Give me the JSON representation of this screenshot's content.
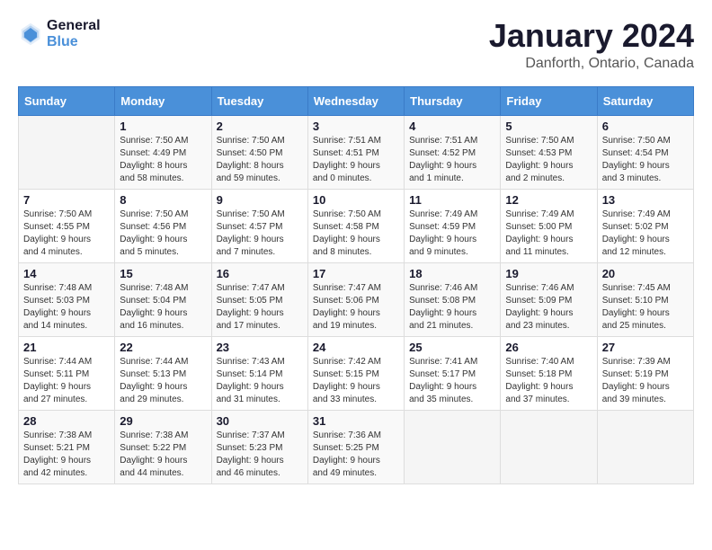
{
  "logo": {
    "line1": "General",
    "line2": "Blue"
  },
  "title": "January 2024",
  "subtitle": "Danforth, Ontario, Canada",
  "days_of_week": [
    "Sunday",
    "Monday",
    "Tuesday",
    "Wednesday",
    "Thursday",
    "Friday",
    "Saturday"
  ],
  "weeks": [
    [
      {
        "day": "",
        "info": ""
      },
      {
        "day": "1",
        "info": "Sunrise: 7:50 AM\nSunset: 4:49 PM\nDaylight: 8 hours\nand 58 minutes."
      },
      {
        "day": "2",
        "info": "Sunrise: 7:50 AM\nSunset: 4:50 PM\nDaylight: 8 hours\nand 59 minutes."
      },
      {
        "day": "3",
        "info": "Sunrise: 7:51 AM\nSunset: 4:51 PM\nDaylight: 9 hours\nand 0 minutes."
      },
      {
        "day": "4",
        "info": "Sunrise: 7:51 AM\nSunset: 4:52 PM\nDaylight: 9 hours\nand 1 minute."
      },
      {
        "day": "5",
        "info": "Sunrise: 7:50 AM\nSunset: 4:53 PM\nDaylight: 9 hours\nand 2 minutes."
      },
      {
        "day": "6",
        "info": "Sunrise: 7:50 AM\nSunset: 4:54 PM\nDaylight: 9 hours\nand 3 minutes."
      }
    ],
    [
      {
        "day": "7",
        "info": "Sunrise: 7:50 AM\nSunset: 4:55 PM\nDaylight: 9 hours\nand 4 minutes."
      },
      {
        "day": "8",
        "info": "Sunrise: 7:50 AM\nSunset: 4:56 PM\nDaylight: 9 hours\nand 5 minutes."
      },
      {
        "day": "9",
        "info": "Sunrise: 7:50 AM\nSunset: 4:57 PM\nDaylight: 9 hours\nand 7 minutes."
      },
      {
        "day": "10",
        "info": "Sunrise: 7:50 AM\nSunset: 4:58 PM\nDaylight: 9 hours\nand 8 minutes."
      },
      {
        "day": "11",
        "info": "Sunrise: 7:49 AM\nSunset: 4:59 PM\nDaylight: 9 hours\nand 9 minutes."
      },
      {
        "day": "12",
        "info": "Sunrise: 7:49 AM\nSunset: 5:00 PM\nDaylight: 9 hours\nand 11 minutes."
      },
      {
        "day": "13",
        "info": "Sunrise: 7:49 AM\nSunset: 5:02 PM\nDaylight: 9 hours\nand 12 minutes."
      }
    ],
    [
      {
        "day": "14",
        "info": "Sunrise: 7:48 AM\nSunset: 5:03 PM\nDaylight: 9 hours\nand 14 minutes."
      },
      {
        "day": "15",
        "info": "Sunrise: 7:48 AM\nSunset: 5:04 PM\nDaylight: 9 hours\nand 16 minutes."
      },
      {
        "day": "16",
        "info": "Sunrise: 7:47 AM\nSunset: 5:05 PM\nDaylight: 9 hours\nand 17 minutes."
      },
      {
        "day": "17",
        "info": "Sunrise: 7:47 AM\nSunset: 5:06 PM\nDaylight: 9 hours\nand 19 minutes."
      },
      {
        "day": "18",
        "info": "Sunrise: 7:46 AM\nSunset: 5:08 PM\nDaylight: 9 hours\nand 21 minutes."
      },
      {
        "day": "19",
        "info": "Sunrise: 7:46 AM\nSunset: 5:09 PM\nDaylight: 9 hours\nand 23 minutes."
      },
      {
        "day": "20",
        "info": "Sunrise: 7:45 AM\nSunset: 5:10 PM\nDaylight: 9 hours\nand 25 minutes."
      }
    ],
    [
      {
        "day": "21",
        "info": "Sunrise: 7:44 AM\nSunset: 5:11 PM\nDaylight: 9 hours\nand 27 minutes."
      },
      {
        "day": "22",
        "info": "Sunrise: 7:44 AM\nSunset: 5:13 PM\nDaylight: 9 hours\nand 29 minutes."
      },
      {
        "day": "23",
        "info": "Sunrise: 7:43 AM\nSunset: 5:14 PM\nDaylight: 9 hours\nand 31 minutes."
      },
      {
        "day": "24",
        "info": "Sunrise: 7:42 AM\nSunset: 5:15 PM\nDaylight: 9 hours\nand 33 minutes."
      },
      {
        "day": "25",
        "info": "Sunrise: 7:41 AM\nSunset: 5:17 PM\nDaylight: 9 hours\nand 35 minutes."
      },
      {
        "day": "26",
        "info": "Sunrise: 7:40 AM\nSunset: 5:18 PM\nDaylight: 9 hours\nand 37 minutes."
      },
      {
        "day": "27",
        "info": "Sunrise: 7:39 AM\nSunset: 5:19 PM\nDaylight: 9 hours\nand 39 minutes."
      }
    ],
    [
      {
        "day": "28",
        "info": "Sunrise: 7:38 AM\nSunset: 5:21 PM\nDaylight: 9 hours\nand 42 minutes."
      },
      {
        "day": "29",
        "info": "Sunrise: 7:38 AM\nSunset: 5:22 PM\nDaylight: 9 hours\nand 44 minutes."
      },
      {
        "day": "30",
        "info": "Sunrise: 7:37 AM\nSunset: 5:23 PM\nDaylight: 9 hours\nand 46 minutes."
      },
      {
        "day": "31",
        "info": "Sunrise: 7:36 AM\nSunset: 5:25 PM\nDaylight: 9 hours\nand 49 minutes."
      },
      {
        "day": "",
        "info": ""
      },
      {
        "day": "",
        "info": ""
      },
      {
        "day": "",
        "info": ""
      }
    ]
  ]
}
